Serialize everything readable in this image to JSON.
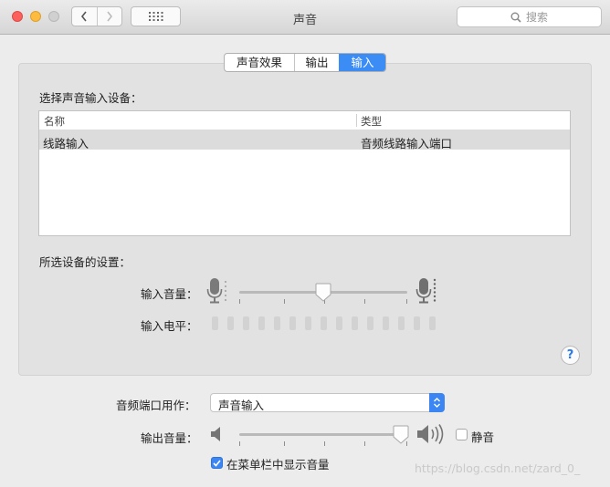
{
  "window": {
    "title": "声音"
  },
  "search": {
    "placeholder": "搜索"
  },
  "tabs": [
    {
      "label": "声音效果",
      "active": false
    },
    {
      "label": "输出",
      "active": false
    },
    {
      "label": "输入",
      "active": true
    }
  ],
  "input": {
    "device_heading": "选择声音输入设备：",
    "columns": [
      "名称",
      "类型"
    ],
    "devices": [
      {
        "name": "线路输入",
        "type": "音频线路输入端口",
        "selected": true
      }
    ],
    "settings_heading": "所选设备的设置：",
    "volume_label": "输入音量：",
    "volume_level": 0.5,
    "level_label": "输入电平：",
    "level_cells": 15,
    "level_lit": 0
  },
  "port": {
    "label": "音频端口用作：",
    "value": "声音输入"
  },
  "output": {
    "label": "输出音量：",
    "volume_level": 0.96,
    "mute_label": "静音",
    "mute_checked": false
  },
  "menubar": {
    "label": "在菜单栏中显示音量",
    "checked": true
  },
  "watermark": "https://blog.csdn.net/zard_0_",
  "colors": {
    "accent": "#3b8cf5",
    "close": "#fc605c",
    "minimize": "#fdbc40",
    "panel": "#e2e2e2"
  },
  "icons": [
    "chevron-left-icon",
    "chevron-right-icon",
    "grid-icon",
    "search-icon",
    "mic-low-icon",
    "mic-high-icon",
    "speaker-low-icon",
    "speaker-high-icon",
    "help-icon",
    "stepper-arrows-icon",
    "checkmark-icon"
  ]
}
